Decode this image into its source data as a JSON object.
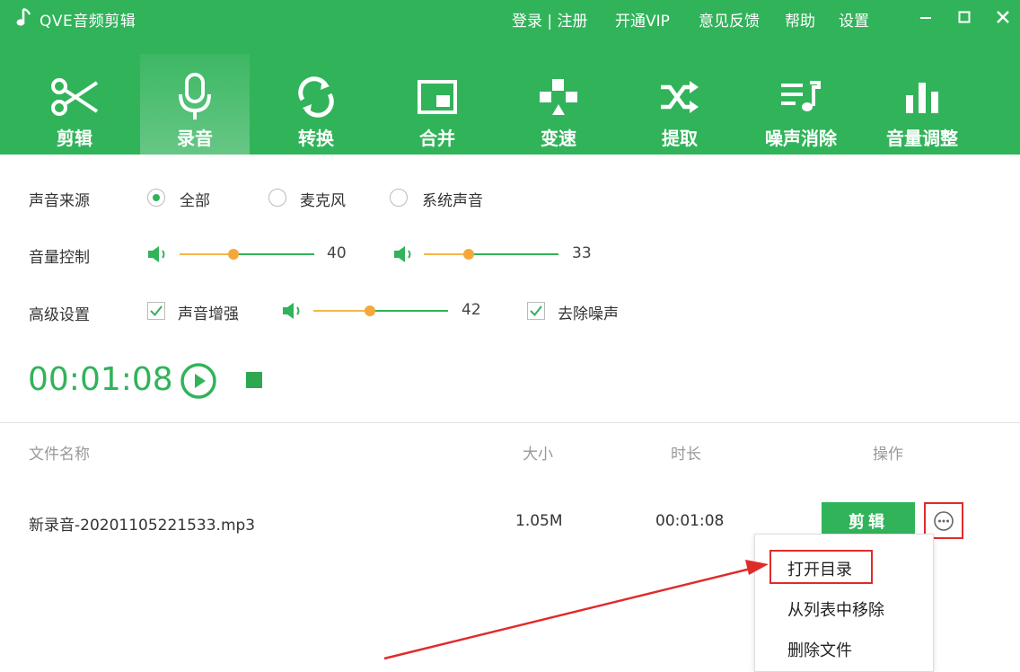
{
  "app": {
    "title": "QVE音频剪辑",
    "accent": "#31b35a",
    "highlight": "#e02b2b"
  },
  "top_links": {
    "login": "登录 | 注册",
    "vip": "开通VIP",
    "feedback": "意见反馈",
    "help": "帮助",
    "settings": "设置"
  },
  "window_controls": [
    "minimize-icon",
    "maximize-icon",
    "close-icon"
  ],
  "toolbar": [
    {
      "label": "剪辑",
      "icon": "scissors-icon"
    },
    {
      "label": "录音",
      "icon": "microphone-icon",
      "active": true
    },
    {
      "label": "转换",
      "icon": "convert-icon"
    },
    {
      "label": "合并",
      "icon": "merge-icon"
    },
    {
      "label": "变速",
      "icon": "speed-icon"
    },
    {
      "label": "提取",
      "icon": "extract-icon"
    },
    {
      "label": "噪声消除",
      "icon": "noise-removal-icon"
    },
    {
      "label": "音量调整",
      "icon": "volume-bars-icon"
    }
  ],
  "settings": {
    "source": {
      "label": "声音来源",
      "options": [
        "全部",
        "麦克风",
        "系统声音"
      ],
      "selected": "全部"
    },
    "volume": {
      "label": "音量控制",
      "mic_value": "40",
      "system_value": "33"
    },
    "advanced": {
      "label": "高级设置",
      "enhance_label": "声音增强",
      "enhance_checked": true,
      "enhance_value": "42",
      "denoise_label": "去除噪声",
      "denoise_checked": true
    }
  },
  "recorder": {
    "time": "00:01:08"
  },
  "table": {
    "headers": {
      "name": "文件名称",
      "size": "大小",
      "duration": "时长",
      "actions": "操作"
    },
    "rows": [
      {
        "name": "新录音-20201105221533.mp3",
        "size": "1.05M",
        "duration": "00:01:08",
        "edit_label": "剪辑"
      }
    ]
  },
  "context_menu": [
    "打开目录",
    "从列表中移除",
    "删除文件"
  ]
}
